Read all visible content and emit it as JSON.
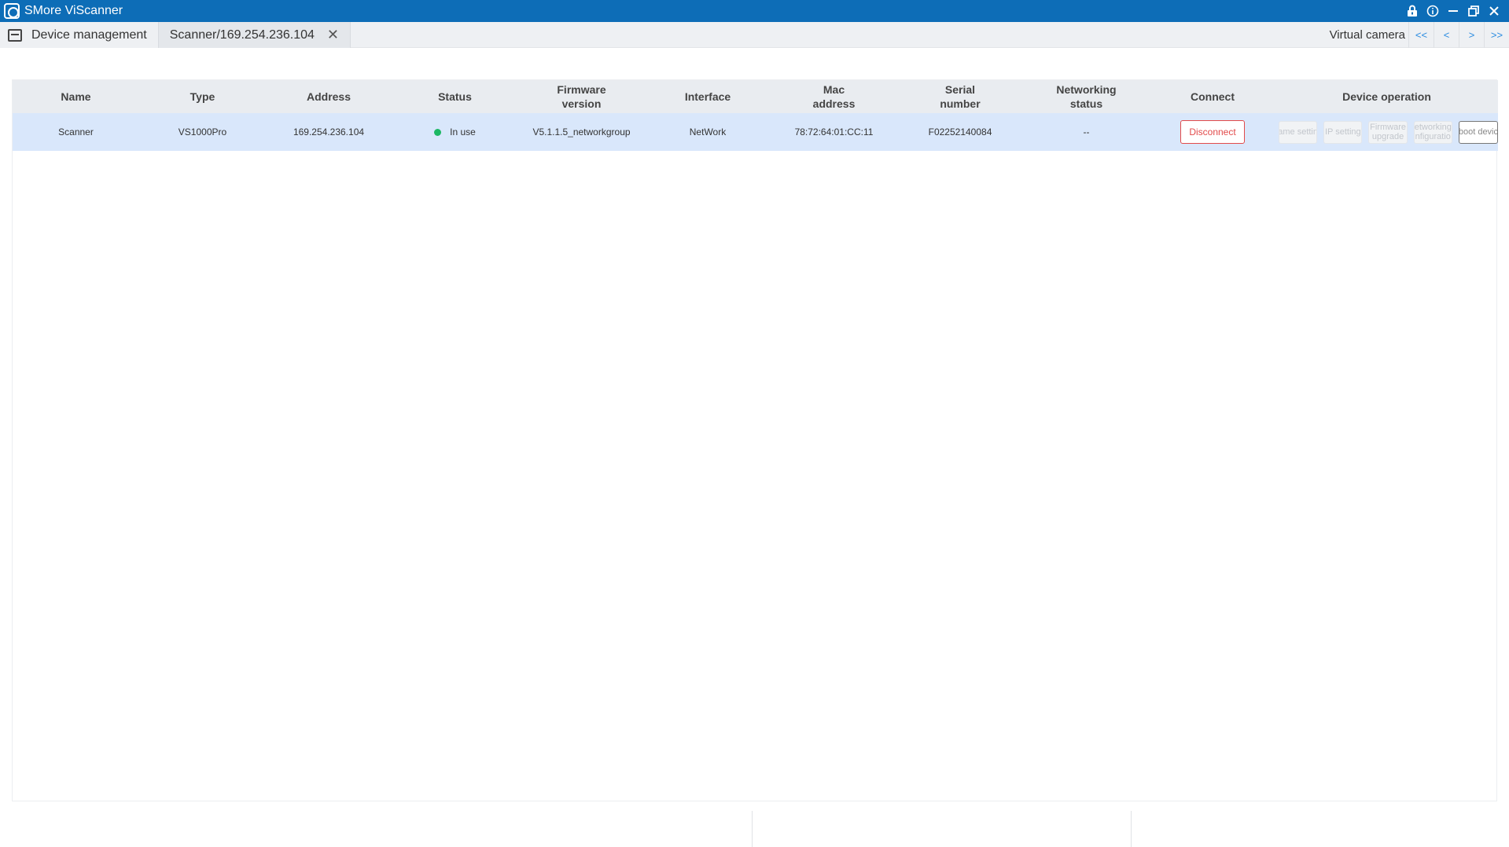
{
  "titlebar": {
    "title": "SMore ViScanner",
    "icons": [
      "app-logo-icon",
      "lock-icon",
      "info-icon",
      "minimize-icon",
      "restore-icon",
      "close-icon"
    ]
  },
  "tabs": [
    {
      "label": "Device management",
      "icon": "device-list-icon"
    },
    {
      "label": "Scanner/169.254.236.104",
      "close": "✕"
    }
  ],
  "nav": {
    "virtual_camera_label": "Virtual camera",
    "first": "<<",
    "prev": "<",
    "next": ">",
    "last": ">>"
  },
  "table": {
    "headers": {
      "name": "Name",
      "type": "Type",
      "address": "Address",
      "status": "Status",
      "firmware": "Firmware version",
      "interface": "Interface",
      "mac": "Mac address",
      "serial": "Serial number",
      "networking": "Networking status",
      "connect": "Connect",
      "operation": "Device operation"
    },
    "row": {
      "name": "Scanner",
      "type": "VS1000Pro",
      "address": "169.254.236.104",
      "status": "In use",
      "status_color": "#1db864",
      "firmware": "V5.1.1.5_networkgroup",
      "interface": "NetWork",
      "mac": "78:72:64:01:CC:11",
      "serial": "F02252140084",
      "networking": "--",
      "connect_label": "Disconnect",
      "ops": {
        "name_setting": "ame settin",
        "ip_setting": "IP setting",
        "firmware_upgrade": "Firmware upgrade",
        "networking_config": "etworking nfiguratio",
        "reboot": "boot devic"
      }
    }
  },
  "colors": {
    "titlebar": "#0d6db7",
    "row_selected": "#d9e7fb",
    "header_bg": "#e9ecf0",
    "danger": "#e24a4a",
    "nav_accent": "#2a8be0"
  }
}
